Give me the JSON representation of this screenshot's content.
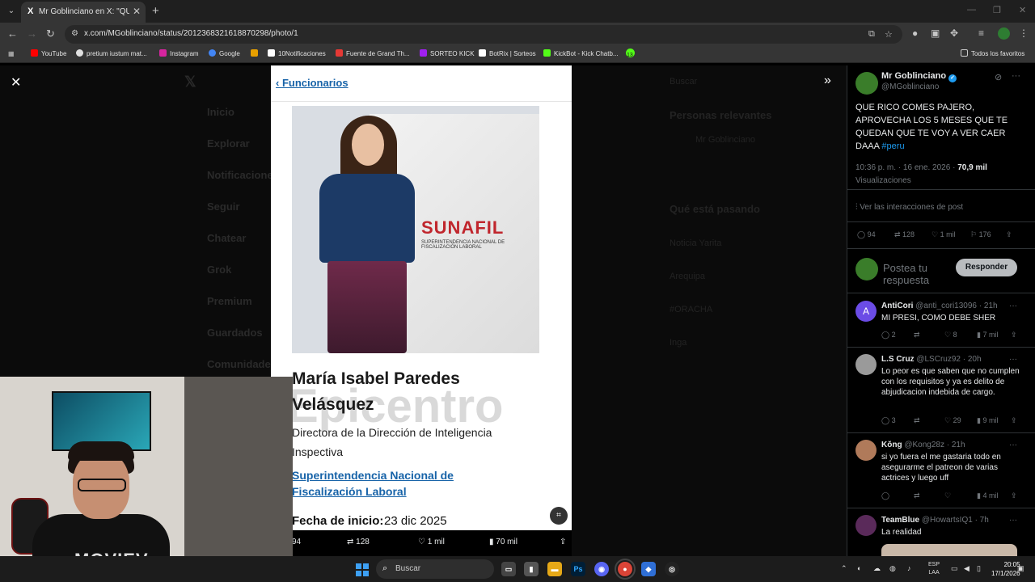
{
  "browser": {
    "tab_title": "Mr Goblinciano en X: \"QUE RIC",
    "tab_favicon": "X",
    "url": "x.com/MGoblinciano/status/2012368321618870298/photo/1",
    "bookmarks": [
      {
        "label": "YouTube",
        "color": "#ff0000"
      },
      {
        "label": "pretium iustum mat...",
        "color": "#e0e0e0"
      },
      {
        "label": "Instagram",
        "color": "#d6249f"
      },
      {
        "label": "Google",
        "color": "#4285f4"
      },
      {
        "label": "",
        "color": "#e8a000"
      },
      {
        "label": "10Notificaciones",
        "color": "#ffffff"
      },
      {
        "label": "Fuente de Grand Th...",
        "color": "#e53935"
      },
      {
        "label": "SORTEO KICK",
        "color": "#a020f0"
      },
      {
        "label": "BotRix | Sorteos",
        "color": "#ffffff"
      },
      {
        "label": "KickBot - Kick Chatb...",
        "color": "#53fc18"
      },
      {
        "label": "13",
        "color": "#53fc18"
      }
    ],
    "all_bookmarks": "Todos los favoritos"
  },
  "background_nav": [
    "Inicio",
    "Explorar",
    "Notificaciones",
    "Seguir",
    "Chatear",
    "Grok",
    "Premium",
    "Guardados",
    "Comunidades"
  ],
  "background_right": [
    "Buscar",
    "Personas relevantes",
    "Mr Goblinciano",
    "Qué está pasando",
    "Noticia Yarita",
    "Arequipa",
    "#ORACHA",
    "Inga"
  ],
  "photo": {
    "back_link": "Funcionarios",
    "name": "María Isabel Paredes Velásquez",
    "watermark": "Epicentro",
    "logo_text": "SUNAFIL",
    "logo_sub": "SUPERINTENDENCIA NACIONAL DE FISCALIZACIÓN LABORAL",
    "role": "Directora de la Dirección de Inteligencia Inspectiva",
    "org": "Superintendencia Nacional de Fiscalización Laboral",
    "start_label": "Fecha de inicio:",
    "start_value": "23 dic 2025",
    "actions": {
      "replies": "94",
      "reposts": "128",
      "likes": "1 mil",
      "views": "70 mil"
    }
  },
  "panel": {
    "author_name": "Mr Goblinciano",
    "author_handle": "@MGoblinciano",
    "tweet_text": "QUE RICO COMES PAJERO, APROVECHA LOS 5 MESES QUE TE QUEDAN QUE TE VOY A VER CAER DAAA",
    "hashtag": "#peru",
    "timestamp": "10:36 p. m. · 16 ene. 2026 ·",
    "views_count": "70,9 mil",
    "views_label": "Visualizaciones",
    "interactions_link": "Ver las interacciones de post",
    "metrics": {
      "replies": "94",
      "reposts": "128",
      "likes": "1 mil",
      "bookmarks": "176"
    },
    "reply_placeholder": "Postea tu respuesta",
    "reply_button": "Responder",
    "replies": [
      {
        "name": "AntiCori",
        "handle": "@anti_cori13096 · 21h",
        "text": "MI PRESI, COMO DEBE SHER",
        "c": "2",
        "l": "8",
        "v": "7 mil",
        "avatar": "#6b4ce6",
        "initial": "A"
      },
      {
        "name": "L.S Cruz",
        "handle": "@LSCruz92 · 20h",
        "text": "Lo peor es que saben que no cumplen con los requisitos y ya es delito de abjudicacion indebida de cargo.",
        "c": "3",
        "l": "29",
        "v": "9 mil",
        "avatar": "#9a9a9a",
        "initial": ""
      },
      {
        "name": "Kŏng",
        "handle": "@Kong28z · 21h",
        "text": "si yo fuera el me gastaria todo en asegurarme el patreon de varias actrices y luego uff",
        "c": "",
        "l": "",
        "v": "4 mil",
        "avatar": "#b07a5a",
        "initial": ""
      },
      {
        "name": "TeamBlue",
        "handle": "@HowartsIQ1 · 7h",
        "text": "La realidad",
        "c": "",
        "l": "",
        "v": "",
        "avatar": "#5a2a5a",
        "initial": ""
      }
    ]
  },
  "webcam": {
    "shirt_text": "MOVIEV"
  },
  "taskbar": {
    "search_placeholder": "Buscar",
    "lang": "ESP",
    "lang_sub": "LAA",
    "time": "20:05",
    "date": "17/1/2026"
  }
}
